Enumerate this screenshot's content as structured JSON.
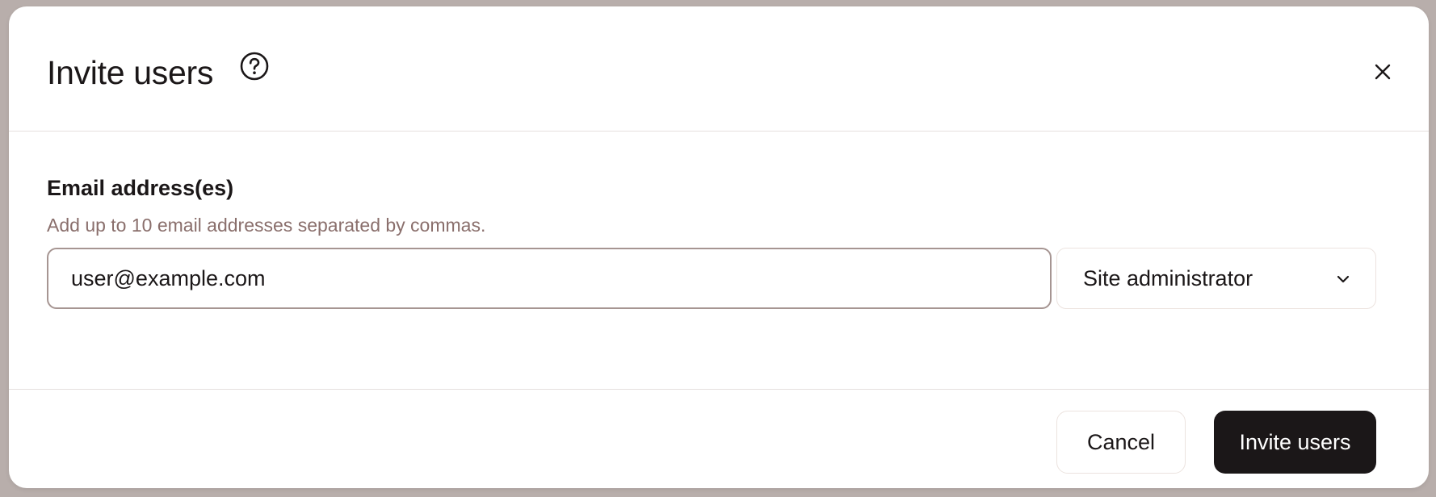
{
  "modal": {
    "title": "Invite users",
    "help_icon": "question-circle-icon",
    "close_icon": "close-icon"
  },
  "form": {
    "email_label": "Email address(es)",
    "email_hint": "Add up to 10 email addresses separated by commas.",
    "email_value": "user@example.com",
    "role_selected": "Site administrator",
    "role_icon": "chevron-down-icon"
  },
  "footer": {
    "cancel_label": "Cancel",
    "submit_label": "Invite users"
  },
  "colors": {
    "primary_button": "#1b1718",
    "hint_text": "#8a6f6c",
    "backdrop": "#b8aeab"
  }
}
